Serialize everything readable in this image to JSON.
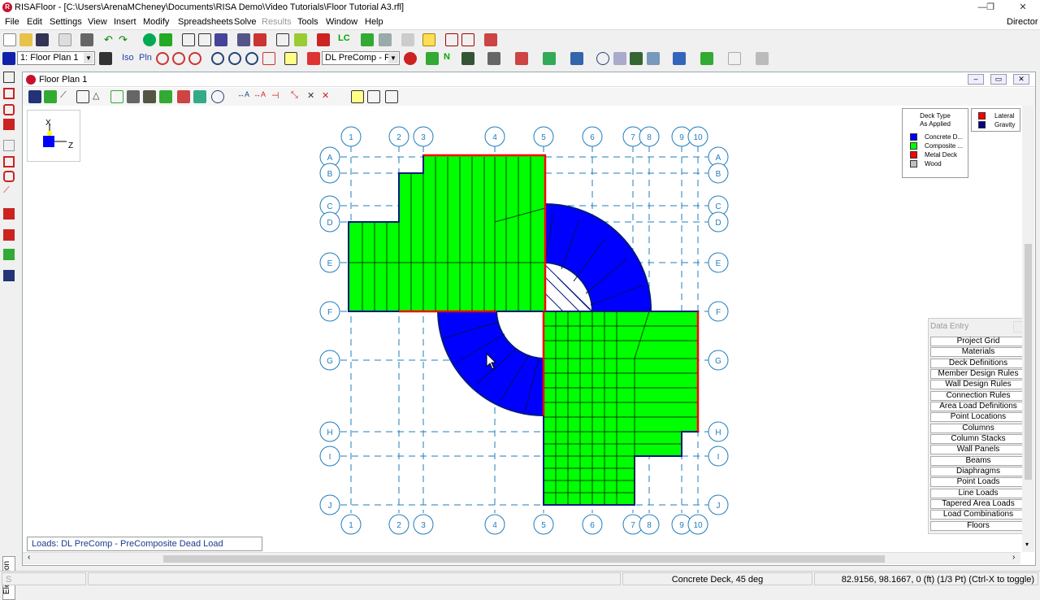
{
  "window": {
    "title": "RISAFloor - [C:\\Users\\ArenaMCheney\\Documents\\RISA Demo\\Video Tutorials\\Floor Tutorial A3.rfl]",
    "minimize": "—",
    "restore": "❐",
    "close": "✕"
  },
  "menu": {
    "items": [
      "File",
      "Edit",
      "Settings",
      "View",
      "Insert",
      "Modify",
      "Spreadsheets",
      "Solve",
      "Results",
      "Tools",
      "Window",
      "Help"
    ],
    "director": "Director"
  },
  "toolbar2": {
    "floor_select": "1: Floor Plan 1",
    "iso": "Iso",
    "pln": "Pln",
    "load_case": "DL PreComp - Pr"
  },
  "floorplan": {
    "title": "Floor Plan 1",
    "axis_x": "X",
    "axis_z": "Z",
    "grid_numbers": [
      "1",
      "2",
      "3",
      "4",
      "5",
      "6",
      "7",
      "8",
      "9",
      "10"
    ],
    "grid_letters": [
      "A",
      "B",
      "C",
      "D",
      "E",
      "F",
      "G",
      "H",
      "I",
      "J"
    ]
  },
  "legend_deck": {
    "title1": "Deck Type",
    "title2": "As Applied",
    "items": [
      {
        "label": "Concrete D...",
        "color": "#0000ff"
      },
      {
        "label": "Composite ...",
        "color": "#00ff00"
      },
      {
        "label": "Metal Deck",
        "color": "#ff0000"
      },
      {
        "label": "Wood",
        "color": "#c0c0c0"
      }
    ]
  },
  "legend_lateral": {
    "items": [
      {
        "label": "Lateral",
        "color": "#ff0000"
      },
      {
        "label": "Gravity",
        "color": "#000080"
      }
    ]
  },
  "data_entry": {
    "title": "Data Entry",
    "buttons": [
      "Project Grid",
      "Materials",
      "Deck Definitions",
      "Member Design Rules",
      "Wall Design Rules",
      "Connection Rules",
      "Area Load Definitions",
      "Point Locations",
      "Columns",
      "Column Stacks",
      "Wall Panels",
      "Beams",
      "Diaphragms",
      "Point Loads",
      "Line Loads",
      "Tapered Area Loads",
      "Load Combinations",
      "Floors"
    ]
  },
  "loads_status": "Loads: DL PreComp - PreComposite Dead Load",
  "elevation_tab": "Elevation",
  "statusbar": {
    "deck": "Concrete Deck, 45 deg",
    "coords": "82.9156, 98.1667, 0 (ft) (1/3 Pt)",
    "hint": "(Ctrl-X to toggle)"
  }
}
